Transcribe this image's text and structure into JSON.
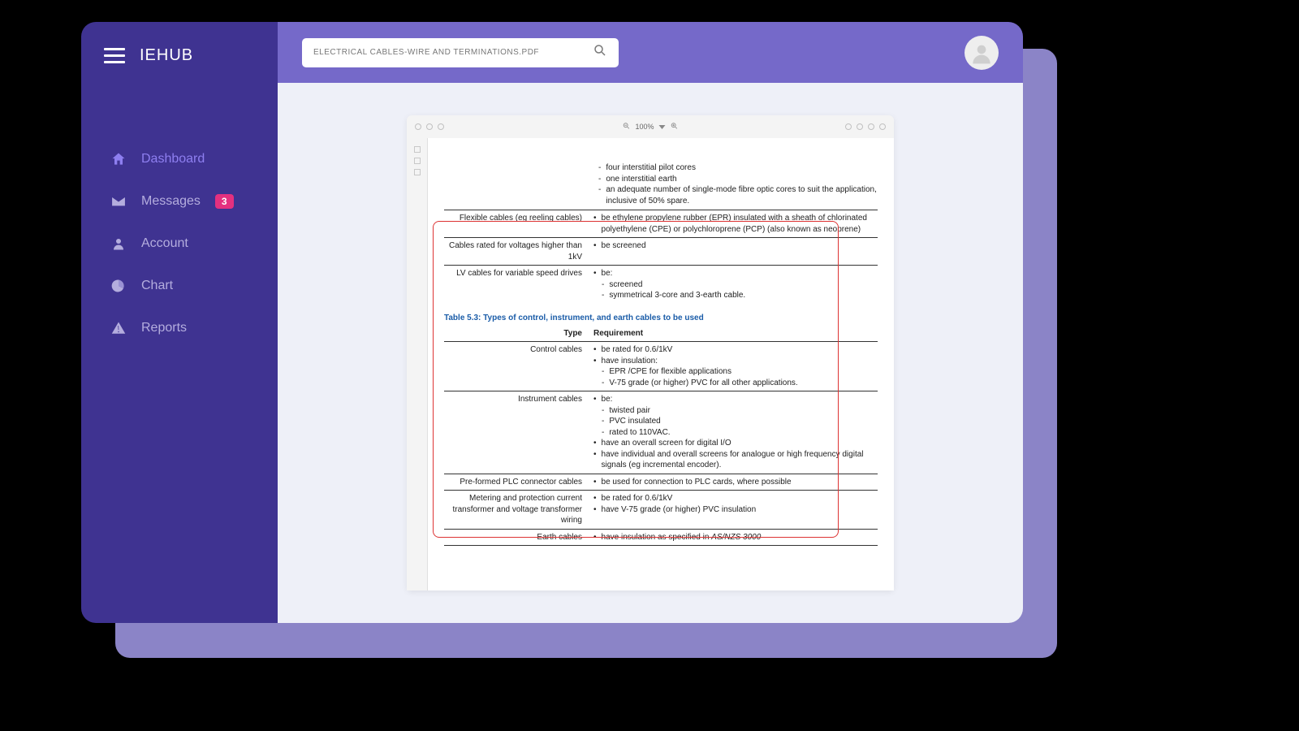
{
  "app": {
    "name": "IEHUB"
  },
  "search": {
    "value": "ELECTRICAL CABLES-WIRE AND TERMINATIONS.PDF"
  },
  "nav": {
    "dashboard": "Dashboard",
    "messages": "Messages",
    "messages_badge": "3",
    "account": "Account",
    "chart": "Chart",
    "reports": "Reports"
  },
  "viewer": {
    "zoom": "100%"
  },
  "doc": {
    "top_bullets": [
      "four interstitial pilot cores",
      "one interstitial earth",
      "an adequate number of single-mode fibre optic cores to suit the application, inclusive of 50% spare."
    ],
    "table1": {
      "rows": [
        {
          "label": "Flexible cables (eg reeling cables)",
          "items": [
            {
              "type": "bullet",
              "text": "be ethylene propylene rubber (EPR) insulated with a sheath of chlorinated polyethylene (CPE) or polychloroprene (PCP) (also known as neoprene)"
            }
          ]
        },
        {
          "label": "Cables rated for voltages higher than 1kV",
          "items": [
            {
              "type": "bullet",
              "text": "be screened"
            }
          ]
        },
        {
          "label": "LV cables for variable speed drives",
          "items": [
            {
              "type": "bullet",
              "text": "be:"
            },
            {
              "type": "dash",
              "text": "screened"
            },
            {
              "type": "dash",
              "text": "symmetrical 3-core and 3-earth cable."
            }
          ]
        }
      ]
    },
    "table2": {
      "title": "Table 5.3: Types of control, instrument, and earth cables to be used",
      "header": {
        "col1": "Type",
        "col2": "Requirement"
      },
      "rows": [
        {
          "label": "Control cables",
          "items": [
            {
              "type": "bullet",
              "text": "be rated for 0.6/1kV"
            },
            {
              "type": "bullet",
              "text": "have insulation:"
            },
            {
              "type": "dash",
              "text": "EPR /CPE for flexible applications"
            },
            {
              "type": "dash",
              "text": "V-75 grade (or higher) PVC for all other applications."
            }
          ]
        },
        {
          "label": "Instrument cables",
          "items": [
            {
              "type": "bullet",
              "text": "be:"
            },
            {
              "type": "dash",
              "text": "twisted pair"
            },
            {
              "type": "dash",
              "text": "PVC insulated"
            },
            {
              "type": "dash",
              "text": "rated to 110VAC."
            },
            {
              "type": "bullet",
              "text": "have an overall screen for digital I/O"
            },
            {
              "type": "bullet",
              "text": "have individual and overall screens for analogue or high frequency digital signals (eg incremental encoder)."
            }
          ]
        },
        {
          "label": "Pre-formed PLC connector cables",
          "items": [
            {
              "type": "bullet",
              "text": "be used for connection to PLC cards, where possible"
            }
          ]
        },
        {
          "label": "Metering and protection current transformer and voltage transformer wiring",
          "items": [
            {
              "type": "bullet",
              "text": "be rated for 0.6/1kV"
            },
            {
              "type": "bullet",
              "text": "have V-75 grade (or higher) PVC insulation"
            }
          ]
        },
        {
          "label": "Earth cables",
          "items": [
            {
              "type": "bullet",
              "text_html": "have insulation as specified in <span class='italic'>AS/NZS 3000</span>"
            }
          ]
        }
      ]
    }
  }
}
